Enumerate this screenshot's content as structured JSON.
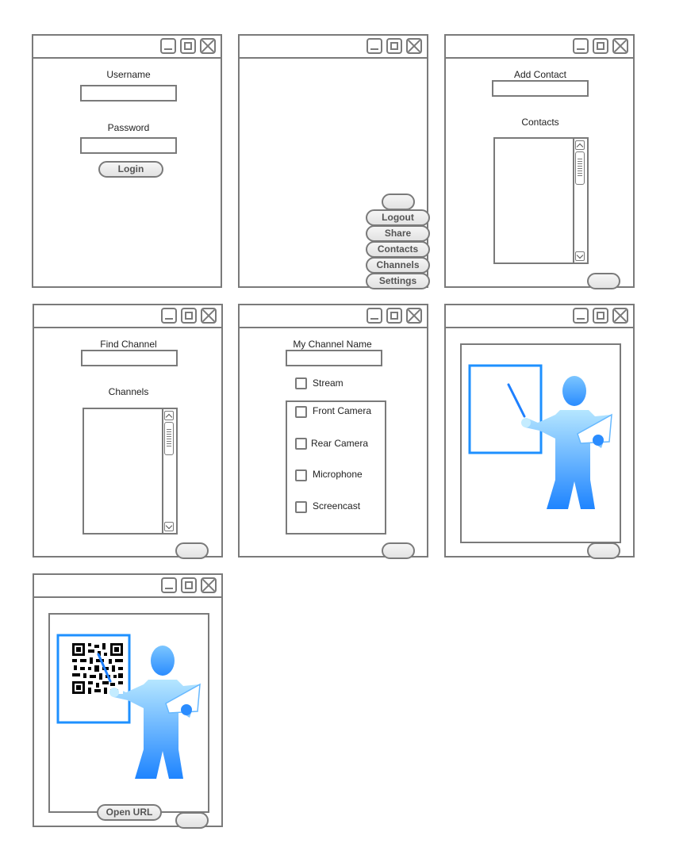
{
  "login": {
    "username_label": "Username",
    "password_label": "Password",
    "login_button": "Login"
  },
  "menu": {
    "blank_button": "",
    "items": [
      "Logout",
      "Share",
      "Contacts",
      "Channels",
      "Settings"
    ]
  },
  "contacts": {
    "add_label": "Add Contact",
    "list_label": "Contacts",
    "footer_button": ""
  },
  "channels": {
    "find_label": "Find Channel",
    "list_label": "Channels",
    "footer_button": ""
  },
  "my_channel": {
    "name_label": "My Channel Name",
    "stream_label": "Stream",
    "options": [
      "Front Camera",
      "Rear Camera",
      "Microphone",
      "Screencast"
    ],
    "footer_button": ""
  },
  "presenter": {
    "footer_button": ""
  },
  "share_qr": {
    "open_url_button": "Open URL",
    "footer_button": ""
  },
  "colors": {
    "border": "#7a7a7a",
    "accent_blue": "#1e90ff",
    "figure_light": "#aee3ff",
    "figure_dark": "#1e88ff"
  },
  "icons": [
    "minimize-icon",
    "maximize-icon",
    "close-icon",
    "scroll-up-arrow-icon",
    "scroll-down-arrow-icon",
    "presenter-figure-icon",
    "qr-code-icon"
  ]
}
